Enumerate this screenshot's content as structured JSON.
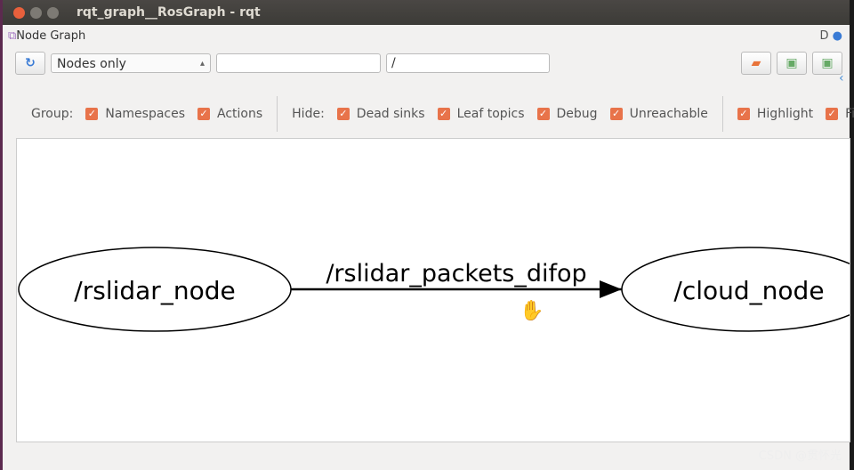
{
  "window": {
    "title": "rqt_graph__RosGraph - rqt"
  },
  "plugin": {
    "title": "Node Graph",
    "d_label": "D"
  },
  "toolbar": {
    "refresh_icon": "refresh-icon",
    "mode": "Nodes only",
    "filter_value": "",
    "namespace_value": "/"
  },
  "group": {
    "label": "Group:",
    "items": [
      {
        "label": "Namespaces",
        "checked": true
      },
      {
        "label": "Actions",
        "checked": true
      }
    ]
  },
  "hide": {
    "label": "Hide:",
    "items": [
      {
        "label": "Dead sinks",
        "checked": true
      },
      {
        "label": "Leaf topics",
        "checked": true
      },
      {
        "label": "Debug",
        "checked": true
      },
      {
        "label": "Unreachable",
        "checked": true
      }
    ]
  },
  "options": {
    "items": [
      {
        "label": "Highlight",
        "checked": true
      },
      {
        "label": "Fit",
        "checked": true
      }
    ]
  },
  "graph": {
    "nodes": [
      "/rslidar_node",
      "/cloud_node"
    ],
    "edge_label": "/rslidar_packets_difop"
  },
  "watermark": "CSDN @贯怀光"
}
